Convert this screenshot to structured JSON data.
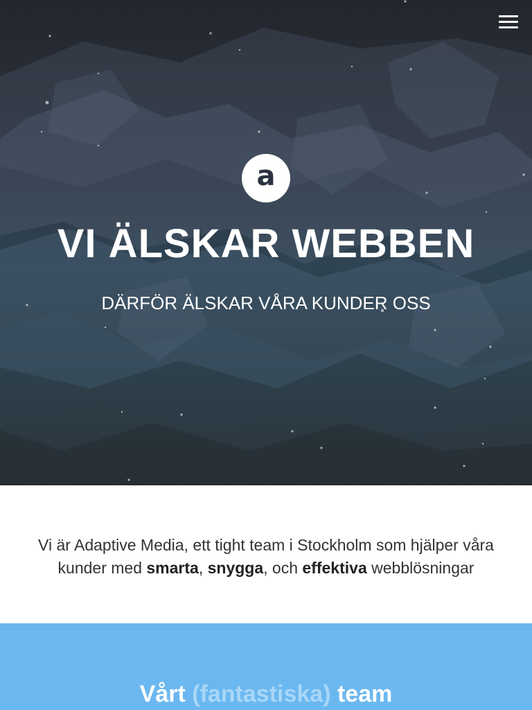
{
  "nav": {
    "menu_icon": "hamburger-menu-icon"
  },
  "hero": {
    "logo_letter": "a",
    "title": "VI ÄLSKAR WEBBEN",
    "subtitle": "DÄRFÖR ÄLSKAR VÅRA KUNDER OSS"
  },
  "intro": {
    "line1": "Vi är Adaptive Media, ett tight team i Stockholm som hjälper våra",
    "line2_prefix": "kunder med ",
    "word1": "smarta",
    "sep1": ", ",
    "word2": "snygga",
    "sep2": ", och ",
    "word3": "effektiva",
    "line2_suffix": " webblösningar"
  },
  "team": {
    "heading_start": "Vårt ",
    "heading_faded": "(fantastiska)",
    "heading_end": " team"
  },
  "colors": {
    "team_background": "#6bb8f0",
    "hero_dark": "#24262c",
    "text_dark": "#333333"
  }
}
